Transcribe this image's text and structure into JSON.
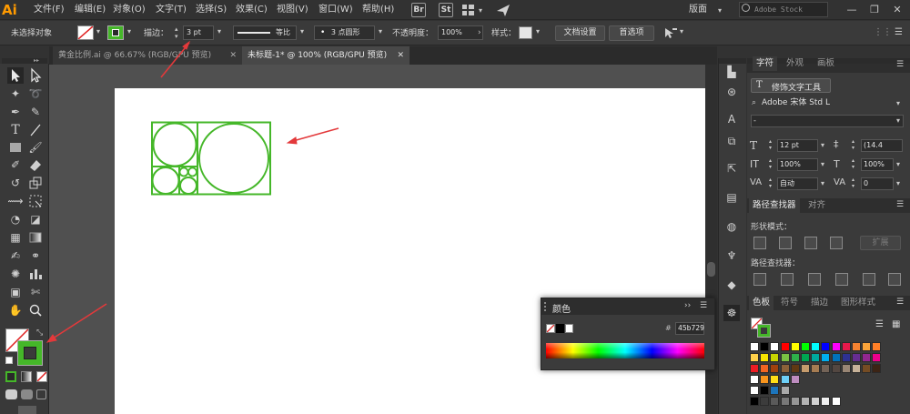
{
  "app": {
    "logo": "Ai"
  },
  "menu": [
    "文件(F)",
    "编辑(E)",
    "对象(O)",
    "文字(T)",
    "选择(S)",
    "效果(C)",
    "视图(V)",
    "窗口(W)",
    "帮助(H)"
  ],
  "app_icons": [
    "Br",
    "St"
  ],
  "workspace": "版面",
  "search_placeholder": "Adobe Stock",
  "control": {
    "selection_label": "未选择对象",
    "stroke_label": "描边：",
    "stroke_weight": "3 pt",
    "profile_label": "等比",
    "brush_label": "3 点圆形",
    "opacity_label": "不透明度：",
    "opacity_value": "100%",
    "style_label": "样式：",
    "doc_setup_btn": "文档设置",
    "prefs_btn": "首选项"
  },
  "tabs": [
    {
      "label": "黄金比例.ai @ 66.67% (RGB/GPU 预览)"
    },
    {
      "label": "未标题-1* @ 100% (RGB/GPU 预览)"
    }
  ],
  "colors": {
    "fill": "#ffffff",
    "stroke": "#45b729",
    "accent": "#45b729",
    "arrow": "#e3393b"
  },
  "color_panel": {
    "title": "颜色",
    "hex_label": "#",
    "hex_value": "45b729"
  },
  "char_panel": {
    "tabs": [
      "字符",
      "外观",
      "画板"
    ],
    "touch_type_btn": "修饰文字工具",
    "font_family": "Adobe 宋体 Std L",
    "font_style": "-",
    "font_size": "12 pt",
    "leading": "(14.4",
    "vscale": "100%",
    "hscale": "100%",
    "kerning": "自动",
    "tracking": "0"
  },
  "pathfinder_panel": {
    "tabs": [
      "路径查找器",
      "对齐"
    ],
    "shape_modes_label": "形状模式：",
    "expand_btn": "扩展",
    "pathfinders_label": "路径查找器："
  },
  "swatches_panel": {
    "tabs": [
      "色板",
      "符号",
      "描边",
      "图形样式"
    ]
  }
}
